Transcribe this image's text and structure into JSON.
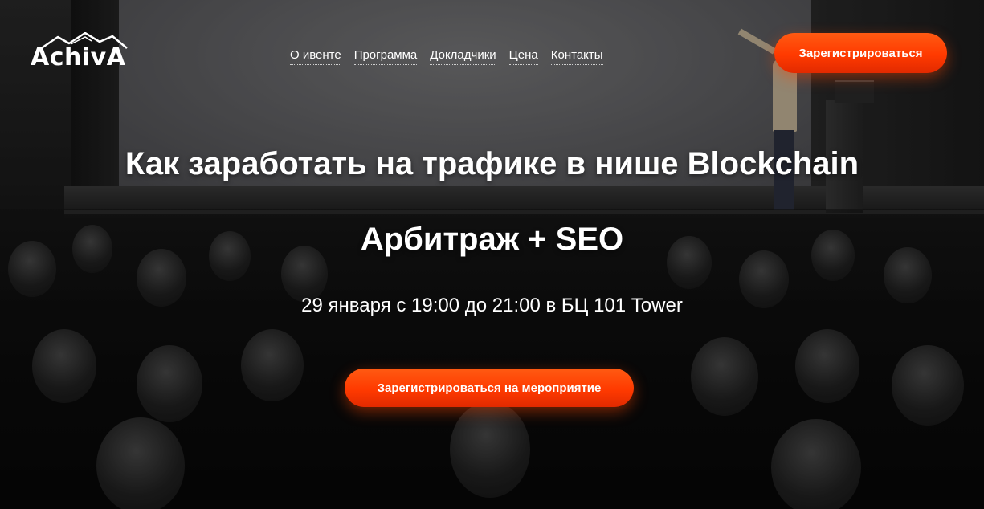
{
  "brand": {
    "logo_text": "AchivA",
    "logo_icon": "mountain-icon"
  },
  "nav": {
    "items": [
      {
        "label": "О ивенте"
      },
      {
        "label": "Программа"
      },
      {
        "label": "Докладчики"
      },
      {
        "label": "Цена"
      },
      {
        "label": "Контакты"
      }
    ]
  },
  "header": {
    "register_label": "Зарегистрироваться"
  },
  "hero": {
    "title": "Как заработать на трафике в нише Blockchain",
    "subtitle": "Арбитраж + SEO",
    "date_line": "29 января с 19:00 до 21:00 в БЦ 101 Tower",
    "cta_label": "Зарегистрироваться на мероприятие"
  },
  "colors": {
    "accent": "#ff4200",
    "text": "#ffffff"
  }
}
